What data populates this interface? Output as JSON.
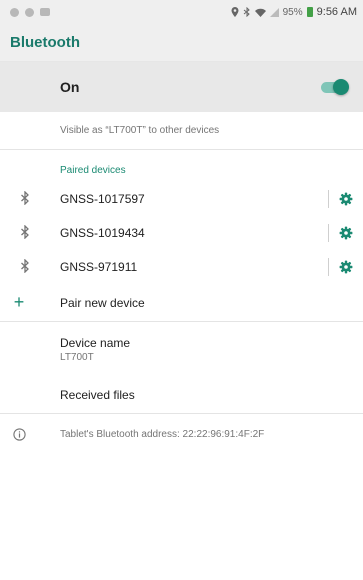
{
  "status_bar": {
    "battery": "95%",
    "time": "9:56 AM",
    "icons": [
      "app-notification-icon",
      "app-notification-icon",
      "image-icon",
      "location-icon",
      "bluetooth-icon",
      "wifi-icon",
      "signal-icon",
      "battery-icon"
    ]
  },
  "app_bar": {
    "title": "Bluetooth"
  },
  "master_switch": {
    "label": "On",
    "enabled": true,
    "accent": "#1a8a72"
  },
  "visibility_text": "Visible as “LT700T” to other devices",
  "paired_section": {
    "header": "Paired devices",
    "devices": [
      {
        "name": "GNSS-1017597"
      },
      {
        "name": "GNSS-1019434"
      },
      {
        "name": "GNSS-971911"
      }
    ]
  },
  "pair_new": {
    "label": "Pair new device"
  },
  "device_name": {
    "title": "Device name",
    "value": "LT700T"
  },
  "received_files": {
    "label": "Received files"
  },
  "address": {
    "text": "Tablet's Bluetooth address: 22:22:96:91:4F:2F"
  }
}
